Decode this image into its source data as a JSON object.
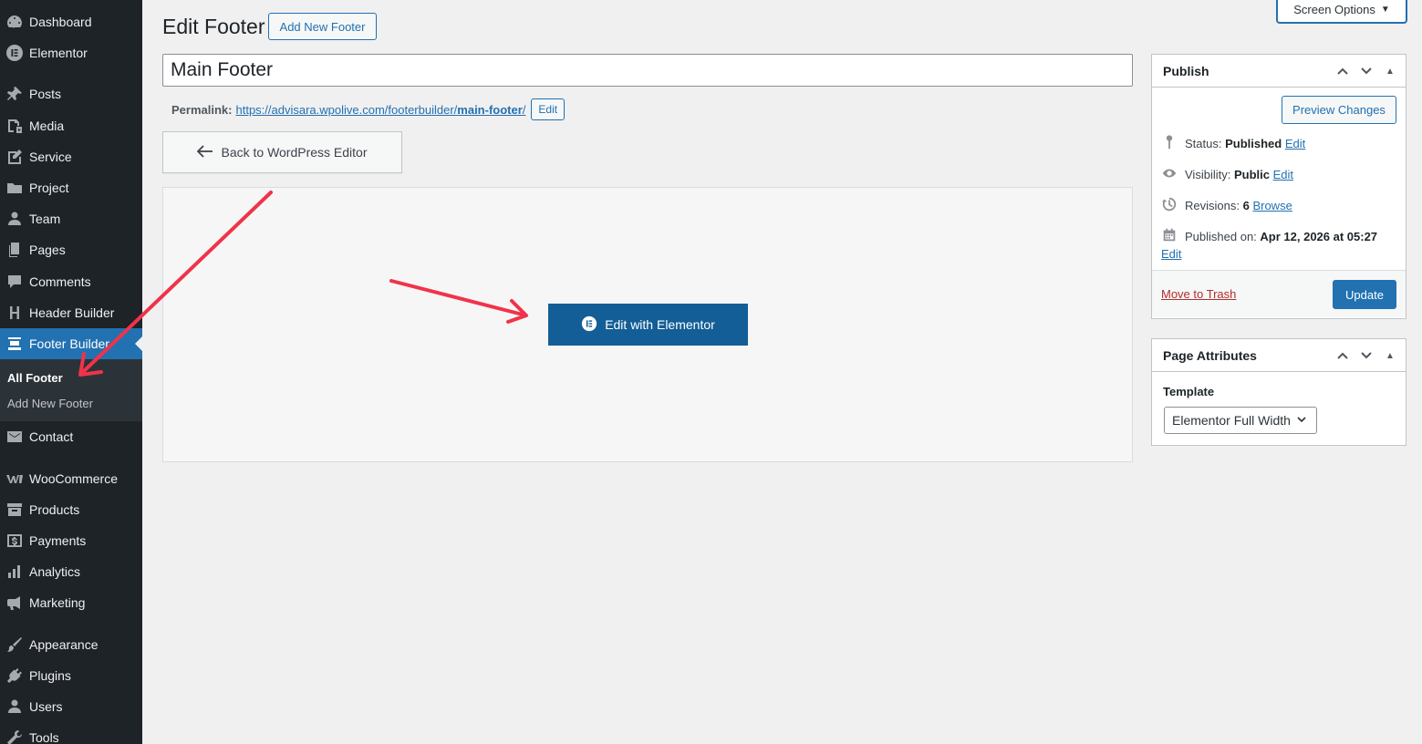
{
  "sidebar": {
    "items": [
      {
        "key": "dashboard",
        "label": "Dashboard",
        "icon": "dashboard-icon"
      },
      {
        "key": "elementor",
        "label": "Elementor",
        "icon": "elementor-icon"
      },
      {
        "key": "posts",
        "label": "Posts",
        "icon": "pin-icon"
      },
      {
        "key": "media",
        "label": "Media",
        "icon": "media-icon"
      },
      {
        "key": "service",
        "label": "Service",
        "icon": "edit-icon"
      },
      {
        "key": "project",
        "label": "Project",
        "icon": "folder-icon"
      },
      {
        "key": "team",
        "label": "Team",
        "icon": "user-icon"
      },
      {
        "key": "pages",
        "label": "Pages",
        "icon": "pages-icon"
      },
      {
        "key": "comments",
        "label": "Comments",
        "icon": "comment-icon"
      },
      {
        "key": "header-builder",
        "label": "Header Builder",
        "icon": "header-icon"
      },
      {
        "key": "footer-builder",
        "label": "Footer Builder",
        "icon": "footer-icon",
        "active": true
      },
      {
        "key": "contact",
        "label": "Contact",
        "icon": "mail-icon"
      },
      {
        "key": "woocommerce",
        "label": "WooCommerce",
        "icon": "woocommerce-icon"
      },
      {
        "key": "products",
        "label": "Products",
        "icon": "archive-icon"
      },
      {
        "key": "payments",
        "label": "Payments",
        "icon": "dollar-icon"
      },
      {
        "key": "analytics",
        "label": "Analytics",
        "icon": "bar-chart-icon"
      },
      {
        "key": "marketing",
        "label": "Marketing",
        "icon": "megaphone-icon"
      },
      {
        "key": "appearance",
        "label": "Appearance",
        "icon": "brush-icon"
      },
      {
        "key": "plugins",
        "label": "Plugins",
        "icon": "plug-icon"
      },
      {
        "key": "users",
        "label": "Users",
        "icon": "users-icon"
      },
      {
        "key": "tools",
        "label": "Tools",
        "icon": "wrench-icon"
      }
    ],
    "submenu": {
      "all_footer": "All Footer",
      "add_new_footer": "Add New Footer"
    }
  },
  "screen_options": "Screen Options",
  "header": {
    "title": "Edit Footer",
    "add_new_label": "Add New Footer"
  },
  "post": {
    "title": "Main Footer",
    "permalink_label": "Permalink:",
    "permalink_base": "https://advisara.wpolive.com/footerbuilder/",
    "permalink_slug": "main-footer",
    "permalink_trail": "/",
    "permalink_edit": "Edit"
  },
  "editor": {
    "back_label": "Back to WordPress Editor",
    "elementor_label": "Edit with Elementor"
  },
  "publish": {
    "title": "Publish",
    "preview_label": "Preview Changes",
    "status_label": "Status:",
    "status_value": "Published",
    "visibility_label": "Visibility:",
    "visibility_value": "Public",
    "revisions_label": "Revisions:",
    "revisions_value": "6",
    "browse_label": "Browse",
    "published_label": "Published on:",
    "published_value": "Apr 12, 2026 at 05:27",
    "edit_label": "Edit",
    "trash_label": "Move to Trash",
    "update_label": "Update"
  },
  "page_attributes": {
    "title": "Page Attributes",
    "template_label": "Template",
    "template_value": "Elementor Full Width"
  },
  "colors": {
    "sidebar_bg": "#1d2327",
    "accent": "#2271b1",
    "elementor_button": "#135e96",
    "arrow": "#f0334a"
  }
}
